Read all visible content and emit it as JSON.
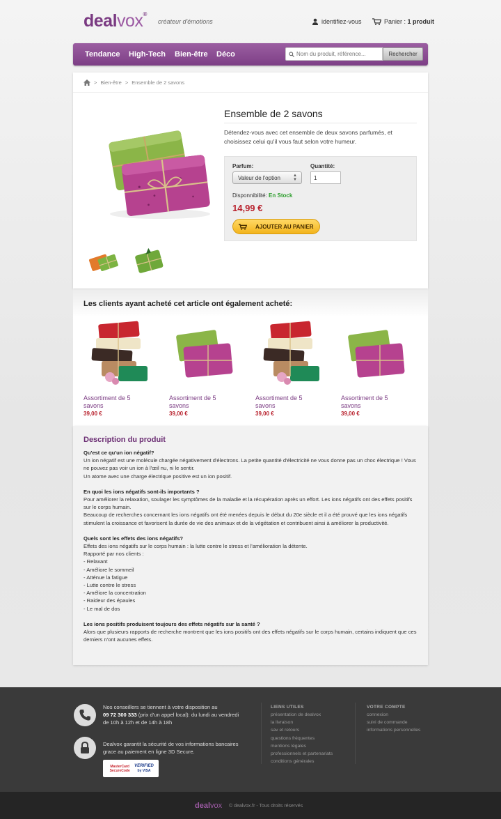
{
  "header": {
    "logo_bold": "deal",
    "logo_light": "vox",
    "logo_mark": "®",
    "tagline": "créateur d'émotions",
    "account_label": "identifiez-vous",
    "cart_prefix": "Panier : ",
    "cart_count": "1 produit"
  },
  "nav": {
    "items": [
      "Tendance",
      "High-Tech",
      "Bien-être",
      "Déco"
    ],
    "search_placeholder": "Nom du produit, référence...",
    "search_button": "Rechercher"
  },
  "breadcrumb": {
    "sep": ">",
    "category": "Bien-être",
    "current": "Ensemble de 2 savons"
  },
  "product": {
    "title": "Ensemble de 2 savons",
    "description": "Détendez-vous avec cet ensemble de deux savons parfumés, et choisissez celui qu'il vous faut selon votre humeur.",
    "option_label": "Parfum:",
    "option_value": "Valeur de l'option",
    "qty_label": "Quantité:",
    "qty_value": "1",
    "availability_label": "Disponnibilité:",
    "availability_value": "En Stock",
    "price": "14,99 €",
    "add_to_cart": "AJOUTER AU PANIER"
  },
  "related": {
    "title": "Les clients ayant acheté cet article ont également acheté:",
    "items": [
      {
        "name": "Assortiment de 5 savons",
        "price": "39,00 €",
        "image": "stack"
      },
      {
        "name": "Assortiment de 5 savons",
        "price": "39,00 €",
        "image": "pair"
      },
      {
        "name": "Assortiment de 5 savons",
        "price": "39,00 €",
        "image": "stack"
      },
      {
        "name": "Assortiment de 5 savons",
        "price": "39,00 €",
        "image": "pair"
      }
    ]
  },
  "description": {
    "title": "Description du produit",
    "sections": [
      {
        "heading": "Qu'est ce qu'un ion négatif?",
        "lines": [
          "Un ion négatif est une molécule chargée négativement d'électrons. La petite quantité d'électricité ne vous donne pas un choc électrique ! Vous ne pouvez pas voir un ion à l'œil nu, ni le sentir.",
          "Un atome avec une charge électrique positive est un ion positif."
        ]
      },
      {
        "heading": "En quoi les ions négatifs sont-ils importants ?",
        "lines": [
          "Pour améliorer la relaxation, soulager les symptômes de la maladie et la récupération après un effort. Les ions négatifs ont des effets positifs sur le corps humain.",
          "Beaucoup de recherches concernant les ions négatifs ont été menées depuis le début du 20e siècle et il a été prouvé que les ions négatifs stimulent la croissance et favorisent la durée de vie des animaux et de la végétation et contribuent ainsi à améliorer la productivité."
        ]
      },
      {
        "heading": "Quels sont les effets des ions négatifs?",
        "lines": [
          "Effets des ions négatifs sur le corps humain : la lutte contre le stress et l'amélioration la détente.",
          "Rapporté par nos clients :",
          "- Relaxant",
          "- Améliore le sommeil",
          "- Atténue la fatigue",
          "- Lutte contre le stress",
          "- Améliore la concentration",
          "- Raideur des épaules",
          "- Le mal de dos"
        ]
      },
      {
        "heading": "Les ions positifs produisent toujours des effets négatifs sur la santé ?",
        "lines": [
          "Alors que plusieurs rapports de recherche montrent que les ions positifs ont des effets négatifs sur le corps humain, certains indiquent que ces derniers n'ont aucunes effets."
        ]
      }
    ]
  },
  "footer": {
    "contact_pre": "Nos conseillers se tiennent à votre disposition au",
    "phone": "09 72 300 333",
    "contact_post": "(prix d'un appel local): du lundi au vendredi de 10h à 12h et de 14h à 18h",
    "security": "Dealvox garantit la sécurité de vos informations bancaires grace au paiement en ligne 3D Secure.",
    "badge_left": "MasterCard SecureCode",
    "badge_right_1": "VERIFIED",
    "badge_right_2": "by VISA",
    "col1_title": "LIENS UTILES",
    "col1_links": [
      "présentation de dealvox",
      "la livraison",
      "sav et retours",
      "questions fréquentes",
      "mentions légales",
      "professionnels et partenariats",
      "conditions générales"
    ],
    "col2_title": "VOTRE COMPTE",
    "col2_links": [
      "connexion",
      "suivi de commande",
      "informations personnelles"
    ],
    "copyright": "© dealvox.fr - Tous droits réservés"
  }
}
